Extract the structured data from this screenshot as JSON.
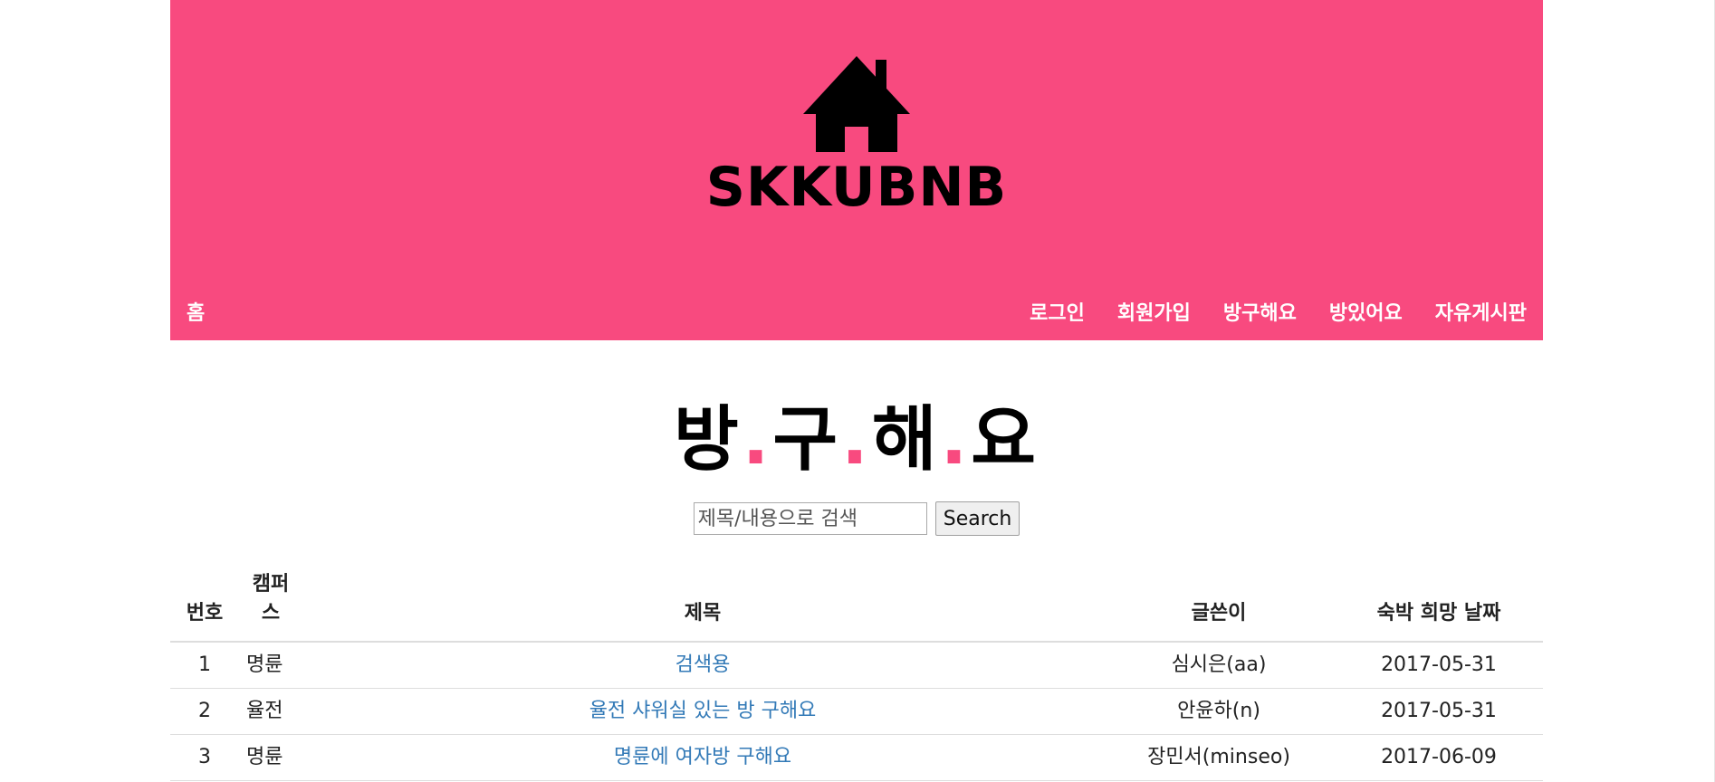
{
  "brand": {
    "name": "SKKUBNB",
    "icon": "house-icon",
    "header_color": "#f84a7f"
  },
  "nav": {
    "home": "홈",
    "items": [
      "로그인",
      "회원가입",
      "방구해요",
      "방있어요",
      "자유게시판"
    ]
  },
  "page": {
    "title_parts": [
      "방",
      ".",
      "구",
      ".",
      "해",
      ".",
      "요"
    ]
  },
  "search": {
    "placeholder": "제목/내용으로 검색",
    "button": "Search"
  },
  "table": {
    "headers": {
      "num": "번호",
      "campus": "캠퍼스",
      "title": "제목",
      "author": "글쓴이",
      "date": "숙박 희망 날짜"
    },
    "rows": [
      {
        "num": "1",
        "campus": "명륜",
        "title": "검색용",
        "author": "심시은(aa)",
        "date": "2017-05-31"
      },
      {
        "num": "2",
        "campus": "율전",
        "title": "율전 샤워실 있는 방 구해요",
        "author": "안윤하(n)",
        "date": "2017-05-31"
      },
      {
        "num": "3",
        "campus": "명륜",
        "title": "명륜에 여자방 구해요",
        "author": "장민서(minseo)",
        "date": "2017-06-09"
      }
    ]
  }
}
